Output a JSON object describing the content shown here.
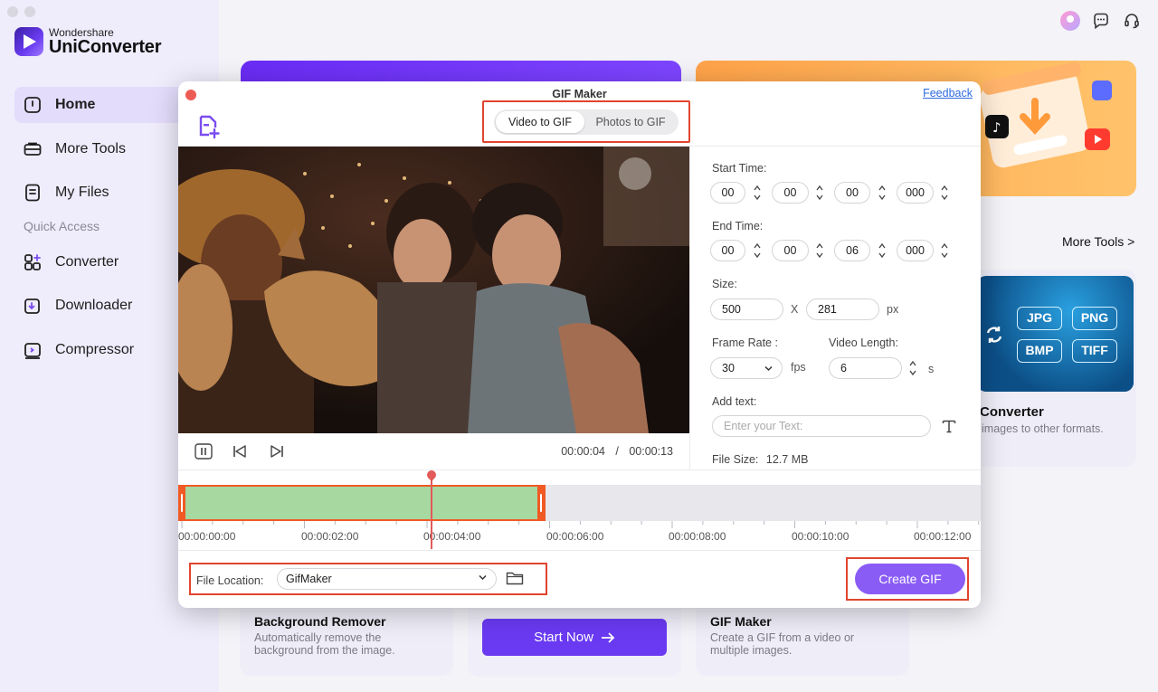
{
  "app": {
    "brand": "Wondershare",
    "product": "UniConverter"
  },
  "sidebar": {
    "items": [
      {
        "label": "Home",
        "icon": "home-icon",
        "active": true
      },
      {
        "label": "More Tools",
        "icon": "toolbox-icon",
        "active": false
      },
      {
        "label": "My Files",
        "icon": "files-icon",
        "active": false
      }
    ],
    "quick_access_title": "Quick Access",
    "quick_items": [
      {
        "label": "Converter",
        "icon": "converter-icon"
      },
      {
        "label": "Downloader",
        "icon": "downloader-icon"
      },
      {
        "label": "Compressor",
        "icon": "compressor-icon"
      }
    ]
  },
  "main": {
    "more_tools_link": "More Tools >",
    "converter_card": {
      "title": "Converter",
      "desc": "images to other formats.",
      "formats": [
        "JPG",
        "PNG",
        "BMP",
        "TIFF"
      ]
    },
    "bottom_cards": [
      {
        "title": "Background Remover",
        "desc": "Automatically remove the background from the image."
      },
      {
        "title": "GIF Maker",
        "desc": "Create a GIF from a video or multiple images."
      }
    ],
    "start_now": "Start Now"
  },
  "dialog": {
    "title": "GIF Maker",
    "feedback": "Feedback",
    "tabs": [
      {
        "label": "Video to GIF",
        "active": true
      },
      {
        "label": "Photos to GIF",
        "active": false
      }
    ],
    "player": {
      "current": "00:00:04",
      "separator": "/",
      "total": "00:00:13"
    },
    "settings": {
      "start_time_label": "Start Time:",
      "start_time": [
        "00",
        "00",
        "00",
        "000"
      ],
      "end_time_label": "End Time:",
      "end_time": [
        "00",
        "00",
        "06",
        "000"
      ],
      "size_label": "Size:",
      "width": "500",
      "size_x": "X",
      "height": "281",
      "size_unit": "px",
      "frame_rate_label": "Frame Rate :",
      "frame_rate": "30",
      "frame_rate_unit": "fps",
      "video_length_label": "Video Length:",
      "video_length": "6",
      "video_length_unit": "s",
      "add_text_label": "Add text:",
      "text_placeholder": "Enter your Text:",
      "file_size_label": "File Size:",
      "file_size": "12.7 MB"
    },
    "timeline": {
      "ticks": [
        "00:00:00:00",
        "00:00:02:00",
        "00:00:04:00",
        "00:00:06:00",
        "00:00:08:00",
        "00:00:10:00",
        "00:00:12:00"
      ],
      "selection_start_seconds": 0,
      "selection_end_seconds": 6,
      "playhead_seconds": 4,
      "duration_seconds": 13
    },
    "footer": {
      "file_location_label": "File Location:",
      "file_location": "GifMaker",
      "create_button": "Create GIF"
    }
  },
  "colors": {
    "accent": "#8a5cf6",
    "highlight_box": "#e0452f",
    "timeline_selection": "#a6d8a0",
    "timeline_handle": "#f15a24"
  }
}
